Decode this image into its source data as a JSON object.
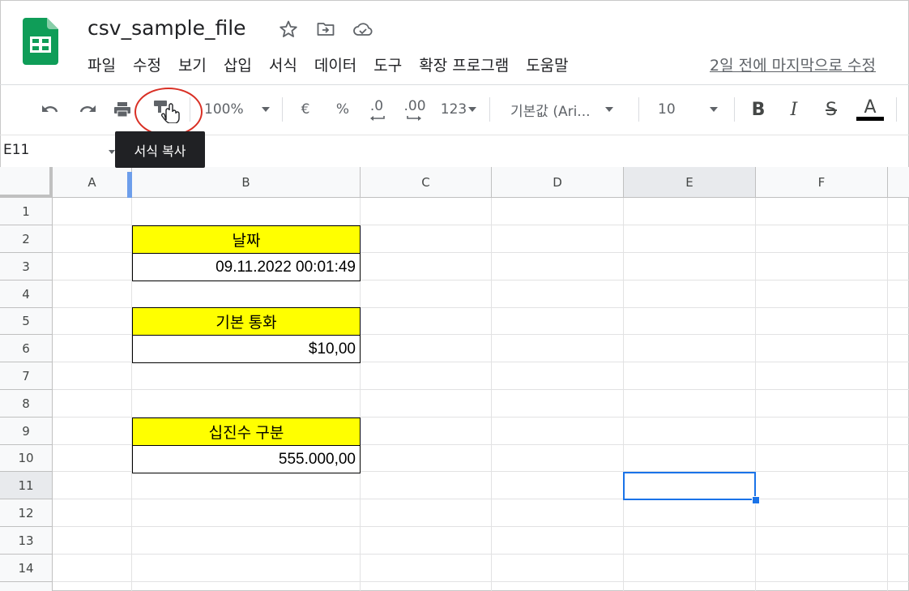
{
  "app": {
    "doc_title": "csv_sample_file",
    "menu": [
      "파일",
      "수정",
      "보기",
      "삽입",
      "서식",
      "데이터",
      "도구",
      "확장 프로그램",
      "도움말"
    ],
    "last_edit": "2일 전에 마지막으로 수정"
  },
  "toolbar": {
    "zoom": "100%",
    "currency": "€",
    "percent": "%",
    "decrease_decimal": ".0",
    "increase_decimal": ".00",
    "more_formats": "123",
    "font": "기본값 (Ari...",
    "font_size": "10",
    "bold": "B",
    "italic": "I",
    "strike": "S",
    "text_color": "A",
    "tooltip": "서식 복사"
  },
  "namebox": "E11",
  "columns": [
    "A",
    "B",
    "C",
    "D",
    "E",
    "F"
  ],
  "rows": [
    "1",
    "2",
    "3",
    "4",
    "5",
    "6",
    "7",
    "8",
    "9",
    "10",
    "11",
    "12",
    "13",
    "14"
  ],
  "cells": {
    "b2": "날짜",
    "b3": "09.11.2022 00:01:49",
    "b5": "기본 통화",
    "b6": "$10,00",
    "b9": "십진수 구분",
    "b10": "555.000,00"
  },
  "colors": {
    "header_fill": "#ffff00",
    "selection": "#1a73e8",
    "highlight_ring": "#d93025",
    "logo": "#0f9d58"
  },
  "selected_cell": "E11"
}
